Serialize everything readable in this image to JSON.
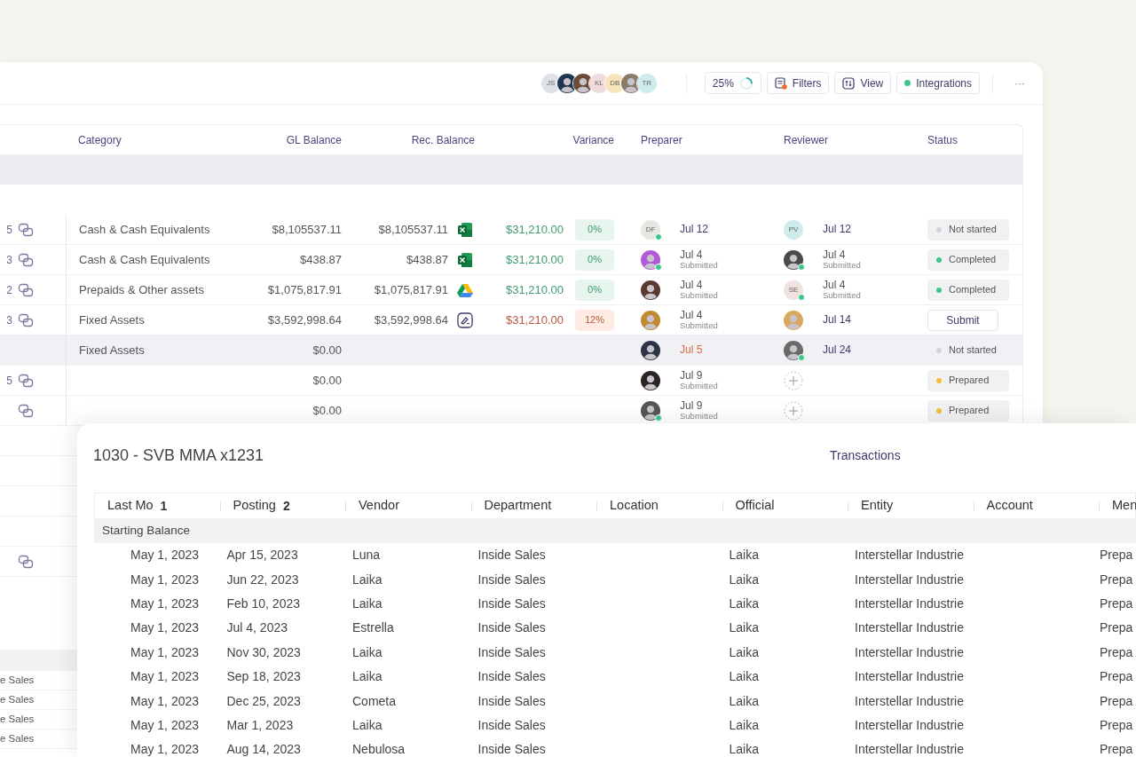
{
  "toolbar": {
    "avatars": [
      {
        "kind": "initials",
        "initials": "JS",
        "color": "#dde1e8"
      },
      {
        "kind": "photo",
        "color": "#1f3550"
      },
      {
        "kind": "photo",
        "color": "#6b4a3a"
      },
      {
        "kind": "initials",
        "initials": "KL",
        "color": "#f1dcdc"
      },
      {
        "kind": "initials",
        "initials": "DB",
        "color": "#f7e4b8"
      },
      {
        "kind": "photo",
        "color": "#8a7a6a"
      },
      {
        "kind": "initials",
        "initials": "TR",
        "color": "#cdeceb"
      }
    ],
    "progress": {
      "label": "25%",
      "level": 0.25
    },
    "buttons": [
      {
        "kind": "filters",
        "label": "Filters",
        "alert": true
      },
      {
        "kind": "view",
        "label": "View"
      },
      {
        "kind": "integrations",
        "label": "Integrations",
        "connected": true
      }
    ],
    "more": "···"
  },
  "table": {
    "columns": [
      "Category",
      "GL Balance",
      "Rec. Balance",
      "Variance",
      "Preparer",
      "Reviewer",
      "Status"
    ],
    "rows": [
      {
        "selected": false,
        "number": "5",
        "linked": true,
        "category": "Cash & Cash  Equivalents",
        "gl_balance": "$8,105537.11",
        "rec_balance": "$8,105537.11",
        "attachment": {
          "kind": "excel"
        },
        "variance": "$31,210.00",
        "variance_pct": "0%",
        "flagged": false,
        "preparer": {
          "kind": "initials",
          "initials": "DF",
          "color": "#e4e8e0",
          "online": true
        },
        "preparer_date": "Jul 12",
        "preparer_overdue": false,
        "reviewer": {
          "kind": "initials",
          "initials": "PV",
          "color": "#cdeceb"
        },
        "reviewer_date": "Jul 12",
        "status": {
          "kind": "not_started",
          "label": "Not started"
        }
      },
      {
        "selected": false,
        "number": "3",
        "linked": true,
        "category": "Cash & Cash  Equivalents",
        "gl_balance": "$438.87",
        "rec_balance": "$438.87",
        "attachment": {
          "kind": "excel"
        },
        "variance": "$31,210.00",
        "variance_pct": "0%",
        "flagged": false,
        "preparer": {
          "kind": "photo",
          "color": "#b05ad8",
          "online": true
        },
        "preparer_date": "Jul 4",
        "preparer_note": "Submitted",
        "preparer_overdue": false,
        "reviewer": {
          "kind": "photo",
          "color": "#4a4a4a",
          "online": true
        },
        "reviewer_date": "Jul 4",
        "reviewer_note": "Submitted",
        "status": {
          "kind": "completed",
          "label": "Completed"
        }
      },
      {
        "selected": false,
        "number": "2",
        "linked": true,
        "category": "Prepaids & Other assets",
        "gl_balance": "$1,075,817.91",
        "rec_balance": "$1,075,817.91",
        "attachment": {
          "kind": "drive"
        },
        "variance": "$31,210.00",
        "variance_pct": "0%",
        "flagged": false,
        "preparer": {
          "kind": "photo",
          "color": "#5a3a30"
        },
        "preparer_date": "Jul 4",
        "preparer_note": "Submitted",
        "preparer_overdue": false,
        "reviewer": {
          "kind": "initials",
          "initials": "SE",
          "color": "#efe2df",
          "online": true
        },
        "reviewer_date": "Jul 4",
        "reviewer_note": "Submitted",
        "status": {
          "kind": "completed",
          "label": "Completed"
        }
      },
      {
        "selected": false,
        "number": "3",
        "linked": true,
        "category": "Fixed Assets",
        "gl_balance": "$3,592,998.64",
        "rec_balance": "$3,592,998.64",
        "attachment": {
          "kind": "signature"
        },
        "variance": "$31,210.00",
        "variance_pct": "12%",
        "flagged": true,
        "preparer": {
          "kind": "photo",
          "color": "#c08a30"
        },
        "preparer_date": "Jul 4",
        "preparer_note": "Submitted",
        "preparer_overdue": false,
        "reviewer": {
          "kind": "photo",
          "color": "#d9a860"
        },
        "reviewer_date": "Jul 14",
        "status": {
          "kind": "button",
          "label": "Submit"
        }
      },
      {
        "selected": true,
        "linked": false,
        "category": "Fixed Assets",
        "gl_balance": "$0.00",
        "preparer": {
          "kind": "photo",
          "color": "#2c3445"
        },
        "preparer_date": "Jul 5",
        "preparer_overdue": true,
        "reviewer": {
          "kind": "photo",
          "color": "#6a6a6a",
          "online": true
        },
        "reviewer_date": "Jul 24",
        "status": {
          "kind": "not_started",
          "label": "Not started"
        }
      },
      {
        "selected": false,
        "number": "5",
        "linked": true,
        "gl_balance": "$0.00",
        "preparer": {
          "kind": "photo",
          "color": "#2a2522"
        },
        "preparer_date": "Jul 9",
        "preparer_note": "Submitted",
        "preparer_overdue": false,
        "reviewer": {
          "kind": "add"
        },
        "status": {
          "kind": "prepared",
          "label": "Prepared"
        }
      },
      {
        "selected": false,
        "linked": true,
        "gl_balance": "$0.00",
        "preparer": {
          "kind": "photo",
          "color": "#555555",
          "online": true
        },
        "preparer_date": "Jul 9",
        "preparer_note": "Submitted",
        "preparer_overdue": false,
        "reviewer": {
          "kind": "add"
        },
        "status": {
          "kind": "prepared",
          "label": "Prepared"
        }
      }
    ],
    "more_rows": [
      {
        "linked": true
      }
    ]
  },
  "lower_table": {
    "rows": [
      "e Sales",
      "e Sales",
      "e Sales",
      "e Sales"
    ]
  },
  "detail": {
    "title": "1030 - SVB MMA x1231",
    "link": "Transactions",
    "columns": [
      {
        "label": "Last Mo",
        "sort": "1"
      },
      {
        "label": "Posting",
        "sort": "2"
      },
      {
        "label": "Vendor"
      },
      {
        "label": "Department"
      },
      {
        "label": "Location"
      },
      {
        "label": "Official"
      },
      {
        "label": "Entity"
      },
      {
        "label": "Account"
      },
      {
        "label": "Men"
      }
    ],
    "group": "Starting Balance",
    "rows": [
      {
        "last_modified": "May 1, 2023",
        "posting_date": "Apr 15, 2023",
        "vendor": "Luna",
        "department": "Inside Sales",
        "official": "Laika",
        "entity": "Interstellar Industrie",
        "memo": "Prepa"
      },
      {
        "last_modified": "May 1, 2023",
        "posting_date": "Jun 22, 2023",
        "vendor": "Laika",
        "department": "Inside Sales",
        "official": "Laika",
        "entity": "Interstellar Industrie",
        "memo": "Prepa"
      },
      {
        "last_modified": "May 1, 2023",
        "posting_date": "Feb 10, 2023",
        "vendor": "Laika",
        "department": "Inside Sales",
        "official": "Laika",
        "entity": "Interstellar Industrie",
        "memo": "Prepa"
      },
      {
        "last_modified": "May 1, 2023",
        "posting_date": "Jul 4, 2023",
        "vendor": "Estrella",
        "department": "Inside Sales",
        "official": "Laika",
        "entity": "Interstellar Industrie",
        "memo": "Prepa"
      },
      {
        "last_modified": "May 1, 2023",
        "posting_date": "Nov 30, 2023",
        "vendor": "Laika",
        "department": "Inside Sales",
        "official": "Laika",
        "entity": "Interstellar Industrie",
        "memo": "Prepa"
      },
      {
        "last_modified": "May 1, 2023",
        "posting_date": "Sep 18, 2023",
        "vendor": "Laika",
        "department": "Inside Sales",
        "official": "Laika",
        "entity": "Interstellar Industrie",
        "memo": "Prepa"
      },
      {
        "last_modified": "May 1, 2023",
        "posting_date": "Dec 25, 2023",
        "vendor": "Cometa",
        "department": "Inside Sales",
        "official": "Laika",
        "entity": "Interstellar Industrie",
        "memo": "Prepa"
      },
      {
        "last_modified": "May 1, 2023",
        "posting_date": "Mar 1, 2023",
        "vendor": "Laika",
        "department": "Inside Sales",
        "official": "Laika",
        "entity": "Interstellar Industrie",
        "memo": "Prepa"
      },
      {
        "last_modified": "May 1, 2023",
        "posting_date": "Aug 14, 2023",
        "vendor": "Nebulosa",
        "department": "Inside Sales",
        "official": "Laika",
        "entity": "Interstellar Industrie",
        "memo": "Prepa"
      }
    ]
  }
}
